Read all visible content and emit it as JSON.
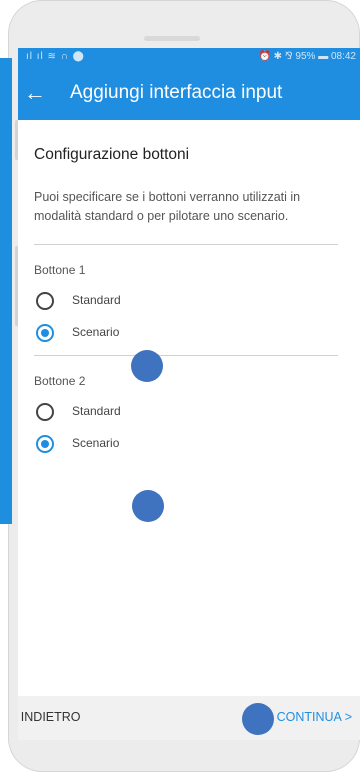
{
  "statusbar": {
    "left_icons": "ıl ıl ≋ ∩ ⬤",
    "right_text": "⏰ ✱ ⅋ 95% ▬ 08:42"
  },
  "appbar": {
    "title": "Aggiungi interfaccia input",
    "back_icon": "arrow-left-icon"
  },
  "main": {
    "section_title": "Configurazione bottoni",
    "description": "Puoi specificare se i bottoni verranno utilizzati in modalità standard o per pilotare uno scenario.",
    "groups": [
      {
        "label": "Bottone 1",
        "options": [
          "Standard",
          "Scenario"
        ],
        "selected": "Scenario"
      },
      {
        "label": "Bottone 2",
        "options": [
          "Standard",
          "Scenario"
        ],
        "selected": "Scenario"
      }
    ]
  },
  "footer": {
    "back_label": "INDIETRO",
    "next_label": "CONTINUA"
  },
  "colors": {
    "primary": "#1f8ee0",
    "touch_marker": "#3f72bf"
  }
}
